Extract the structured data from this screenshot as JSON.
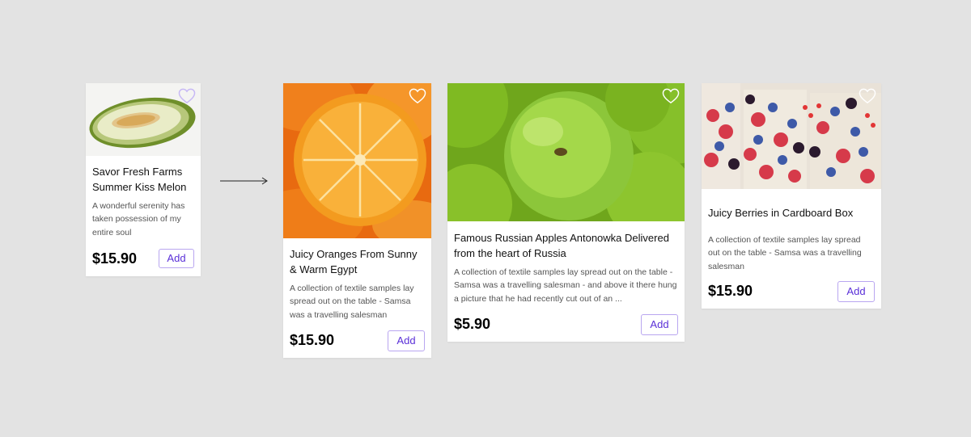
{
  "colors": {
    "background": "#e3e3e3",
    "card": "#ffffff",
    "accent": "#5a2fd8",
    "button_border": "#b9a6f0",
    "heart": "#ffffff"
  },
  "icons": {
    "favorite": "heart-outline-icon",
    "flow": "arrow-right-icon"
  },
  "cards": [
    {
      "image": "melon",
      "title": "Savor Fresh Farms Summer Kiss Melon",
      "description": "A wonderful serenity has taken possession of my entire soul",
      "price": "$15.90",
      "add_label": "Add"
    },
    {
      "image": "oranges",
      "title": "Juicy Oranges From Sunny & Warm Egypt",
      "description": "A collection of textile samples lay spread out on the table - Samsa was a travelling salesman",
      "price": "$15.90",
      "add_label": "Add"
    },
    {
      "image": "green-apples",
      "title": "Famous Russian Apples Antonowka Delivered from the heart of Russia",
      "description": "A collection of textile samples lay spread out on the table - Samsa was a travelling salesman - and above it there hung a picture that he had recently cut out of an ...",
      "price": "$5.90",
      "add_label": "Add"
    },
    {
      "image": "berries",
      "title": "Juicy Berries in Cardboard Box",
      "description": "A collection of textile samples lay spread out on the table - Samsa was a travelling salesman",
      "price": "$15.90",
      "add_label": "Add"
    }
  ]
}
